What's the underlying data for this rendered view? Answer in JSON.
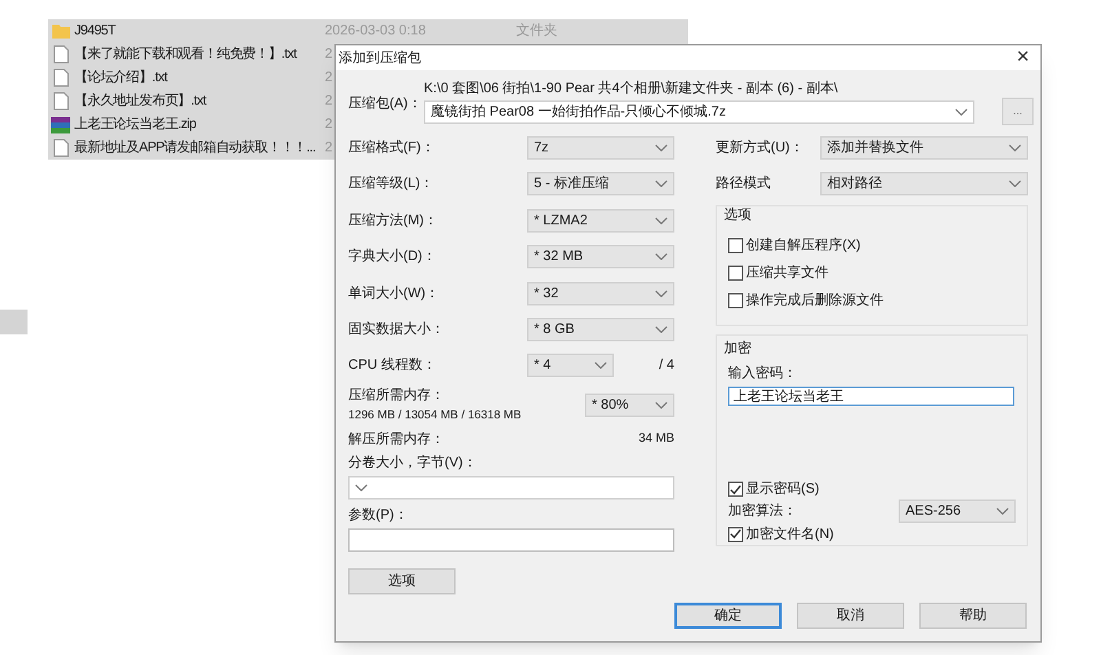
{
  "files": [
    {
      "name": "J9495T",
      "kind": "folder",
      "date": "2026-03-03 0:18",
      "type": "文件夹",
      "selected": true
    },
    {
      "name": "【来了就能下载和观看！纯免费！】.txt",
      "kind": "text",
      "date": "2",
      "selected": true
    },
    {
      "name": "【论坛介绍】.txt",
      "kind": "text",
      "date": "2",
      "selected": true
    },
    {
      "name": "【永久地址发布页】.txt",
      "kind": "text",
      "date": "2",
      "selected": true
    },
    {
      "name": "上老王论坛当老王.zip",
      "kind": "archive",
      "date": "2",
      "selected": true
    },
    {
      "name": "最新地址及APP请发邮箱自动获取！！！...",
      "kind": "text",
      "date": "2",
      "selected": true
    }
  ],
  "dialog": {
    "title": "添加到压缩包",
    "close": "×",
    "archive": {
      "label": "压缩包(A)：",
      "path": "K:\\0 套图\\06 街拍\\1-90 Pear   共4个相册\\新建文件夹 - 副本 (6) - 副本\\",
      "value": "魔镜街拍 Pear08 一始街拍作品-只倾心不倾城.7z",
      "browse": "..."
    },
    "left": [
      {
        "kind": "select",
        "label": "压缩格式(F)：",
        "value": "7z"
      },
      {
        "kind": "select",
        "label": "压缩等级(L)：",
        "value": "5 - 标准压缩"
      },
      {
        "kind": "select",
        "label": "压缩方法(M)：",
        "value": "* LZMA2"
      },
      {
        "kind": "select",
        "label": "字典大小(D)：",
        "value": "* 32 MB"
      },
      {
        "kind": "select",
        "label": "单词大小(W)：",
        "value": "* 32"
      },
      {
        "kind": "select",
        "label": "固实数据大小：",
        "value": "* 8 GB"
      },
      {
        "kind": "threads",
        "label": "CPU 线程数：",
        "value": "* 4",
        "suffix": "/ 4"
      },
      {
        "kind": "memory",
        "label": "压缩所需内存：",
        "detail": "1296 MB / 13054 MB / 16318 MB",
        "value": "* 80%"
      },
      {
        "kind": "info",
        "label": "解压所需内存：",
        "value": "34 MB"
      },
      {
        "kind": "combo",
        "label": "分卷大小，字节(V)："
      },
      {
        "kind": "field",
        "label": "参数(P)："
      }
    ],
    "options_button": "选项",
    "right": [
      {
        "label": "更新方式(U)：",
        "value": "添加并替换文件"
      },
      {
        "label": "路径模式",
        "value": "相对路径"
      }
    ],
    "options": {
      "title": "选项",
      "items": [
        {
          "label": "创建自解压程序(X)",
          "checked": false
        },
        {
          "label": "压缩共享文件",
          "checked": false
        },
        {
          "label": "操作完成后删除源文件",
          "checked": false
        }
      ]
    },
    "encryption": {
      "title": "加密",
      "password_label": "输入密码：",
      "password": "上老王论坛当老王",
      "show_password": {
        "label": "显示密码(S)",
        "checked": true
      },
      "method_label": "加密算法：",
      "method": "AES-256",
      "encrypt_names": {
        "label": "加密文件名(N)",
        "checked": true
      }
    },
    "buttons": [
      {
        "label": "确定",
        "default": true
      },
      {
        "label": "取消",
        "default": false
      },
      {
        "label": "帮助",
        "default": false
      }
    ]
  }
}
